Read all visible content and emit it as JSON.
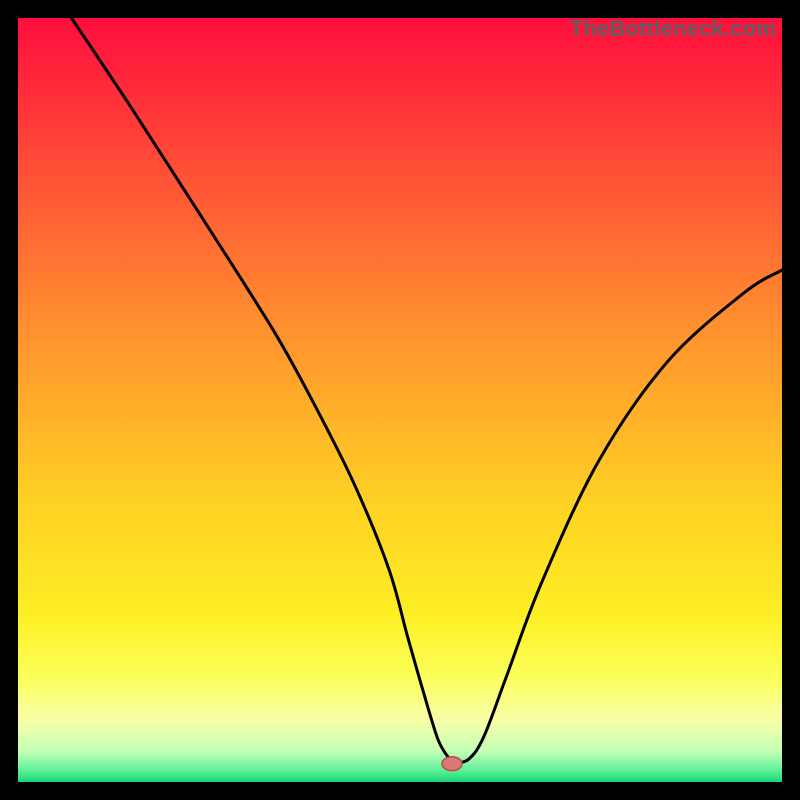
{
  "watermark": {
    "text": "TheBottleneck.com"
  },
  "chart_data": {
    "type": "line",
    "title": "",
    "xlabel": "",
    "ylabel": "",
    "xlim": [
      0,
      100
    ],
    "ylim": [
      0,
      100
    ],
    "series": [
      {
        "name": "bottleneck-curve",
        "x": [
          7,
          15,
          24,
          33.5,
          39,
          44,
          48.5,
          51,
          53,
          55,
          56.5,
          57,
          59,
          61,
          64,
          68.5,
          76,
          85,
          95,
          100
        ],
        "y": [
          100,
          88,
          74,
          59,
          49,
          39,
          28,
          19,
          12,
          5.5,
          3,
          2.5,
          3,
          6,
          14,
          26,
          42,
          55,
          64,
          67
        ]
      }
    ],
    "marker": {
      "x": 56.8,
      "y": 2.4
    },
    "gradient_stops": [
      {
        "offset": 0.0,
        "color": "#ff0d3d"
      },
      {
        "offset": 0.2,
        "color": "#ff4f36"
      },
      {
        "offset": 0.4,
        "color": "#ff8f2f"
      },
      {
        "offset": 0.63,
        "color": "#ffd024"
      },
      {
        "offset": 0.78,
        "color": "#feee24"
      },
      {
        "offset": 0.86,
        "color": "#fcff58"
      },
      {
        "offset": 0.92,
        "color": "#f6ffa8"
      },
      {
        "offset": 0.96,
        "color": "#c3ffb6"
      },
      {
        "offset": 0.985,
        "color": "#5ef098"
      },
      {
        "offset": 1.0,
        "color": "#15d577"
      }
    ],
    "marker_style": {
      "fill": "#d77a78",
      "stroke": "#b84f48"
    }
  }
}
